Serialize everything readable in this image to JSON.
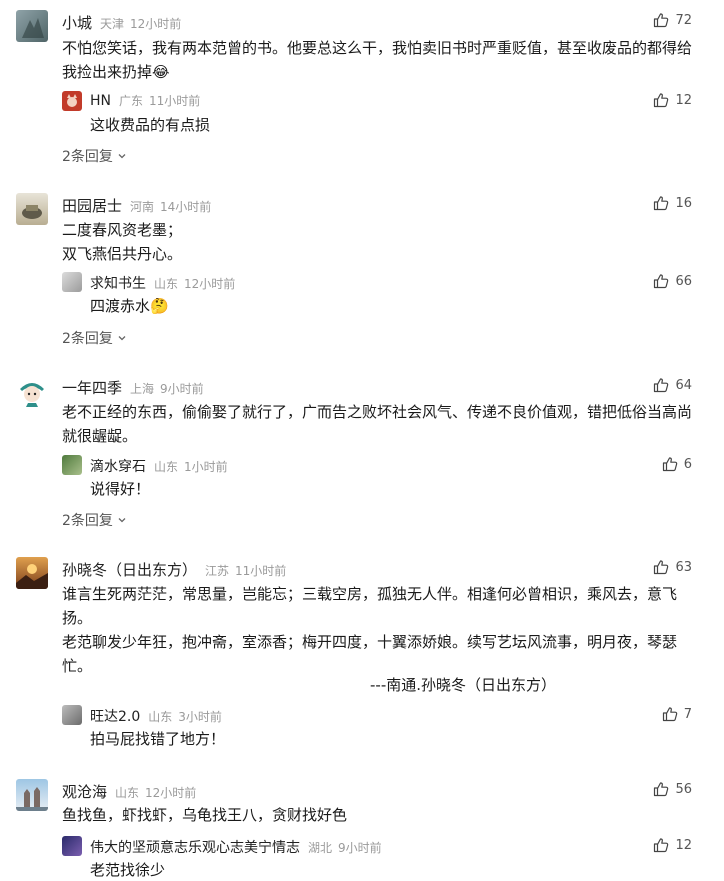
{
  "comments": [
    {
      "username": "小城",
      "location": "天津",
      "time": "12小时前",
      "likes": "72",
      "text_lines": [
        "不怕您笑话，我有两本范曾的书。他要总这么干，我怕卖旧书时严重贬值，甚至收废品的都得给",
        "我捡出来扔掉😂"
      ],
      "reply": {
        "username": "HN",
        "location": "广东",
        "time": "11小时前",
        "likes": "12",
        "text": "这收费品的有点损"
      },
      "more_replies": "2条回复"
    },
    {
      "username": "田园居士",
      "location": "河南",
      "time": "14小时前",
      "likes": "16",
      "text_lines": [
        "二度春风资老墨；",
        "双飞燕侣共丹心。"
      ],
      "reply": {
        "username": "求知书生",
        "location": "山东",
        "time": "12小时前",
        "likes": "66",
        "text": "四渡赤水🤔"
      },
      "more_replies": "2条回复"
    },
    {
      "username": "一年四季",
      "location": "上海",
      "time": "9小时前",
      "likes": "64",
      "text_lines": [
        "老不正经的东西，偷偷娶了就行了，广而告之败坏社会风气、传递不良价值观，错把低俗当高尚",
        "就很龌龊。"
      ],
      "reply": {
        "username": "滴水穿石",
        "location": "山东",
        "time": "1小时前",
        "likes": "6",
        "text": "说得好！"
      },
      "more_replies": "2条回复"
    },
    {
      "username": "孙晓冬（日出东方）",
      "location": "江苏",
      "time": "11小时前",
      "likes": "63",
      "text_lines": [
        "谁言生死两茫茫，常思量，岂能忘；三载空房，孤独无人伴。相逢何必曾相识，乘风去，意飞",
        "扬。",
        "老范聊发少年狂，抱冲斋，室添香；梅开四度，十翼添娇娘。续写艺坛风流事，明月夜，琴瑟",
        "忙。"
      ],
      "signature": "---南通.孙晓冬（日出东方）",
      "reply": {
        "username": "旺达2.0",
        "location": "山东",
        "time": "3小时前",
        "likes": "7",
        "text": "拍马屁找错了地方！"
      }
    },
    {
      "username": "观沧海",
      "location": "山东",
      "time": "12小时前",
      "likes": "56",
      "text_lines": [
        "鱼找鱼，虾找虾，乌龟找王八，贪财找好色"
      ],
      "reply": {
        "username": "伟大的坚顽意志乐观心志美宁情志",
        "location": "湖北",
        "time": "9小时前",
        "likes": "12",
        "text": "老范找徐少"
      }
    }
  ],
  "icons": {
    "like": "thumbs-up-icon",
    "expand": "chevron-down-icon"
  },
  "colors": {
    "meta_gray": "#9a9a9a",
    "text": "#1a1a1a"
  }
}
